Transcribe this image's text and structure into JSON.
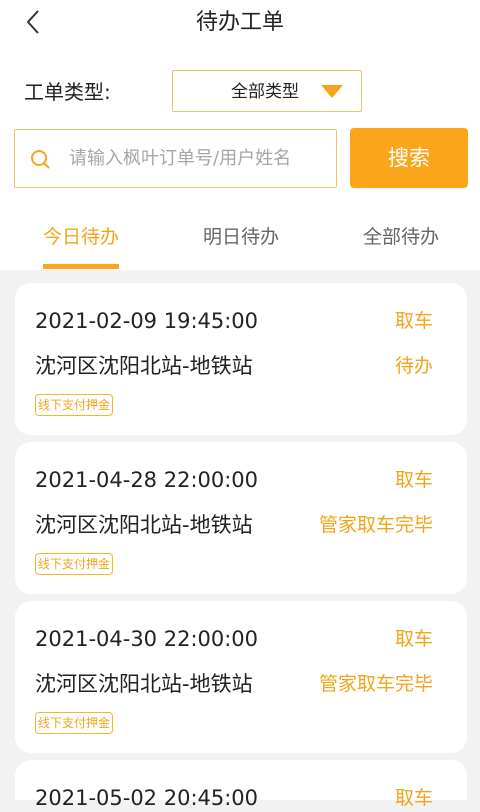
{
  "header": {
    "title": "待办工单"
  },
  "filter": {
    "type_label": "工单类型:",
    "type_value": "全部类型"
  },
  "search": {
    "placeholder": "请输入枫叶订单号/用户姓名",
    "button_label": "搜索"
  },
  "tabs": [
    {
      "label": "今日待办",
      "active": true
    },
    {
      "label": "明日待办",
      "active": false
    },
    {
      "label": "全部待办",
      "active": false
    }
  ],
  "orders": [
    {
      "time": "2021-02-09 19:45:00",
      "action": "取车",
      "location": "沈河区沈阳北站-地铁站",
      "status": "待办",
      "badge": "线下支付押金"
    },
    {
      "time": "2021-04-28 22:00:00",
      "action": "取车",
      "location": "沈河区沈阳北站-地铁站",
      "status": "管家取车完毕",
      "badge": "线下支付押金"
    },
    {
      "time": "2021-04-30 22:00:00",
      "action": "取车",
      "location": "沈河区沈阳北站-地铁站",
      "status": "管家取车完毕",
      "badge": "线下支付押金"
    },
    {
      "time": "2021-05-02 20:45:00",
      "action": "取车"
    }
  ],
  "colors": {
    "accent": "#fba51b",
    "accent_text": "#f3a41c",
    "border": "#f0c46a",
    "background": "#f2f2f2"
  },
  "icons": {
    "back": "chevron-left-icon",
    "dropdown": "triangle-down-icon",
    "search": "search-icon"
  }
}
